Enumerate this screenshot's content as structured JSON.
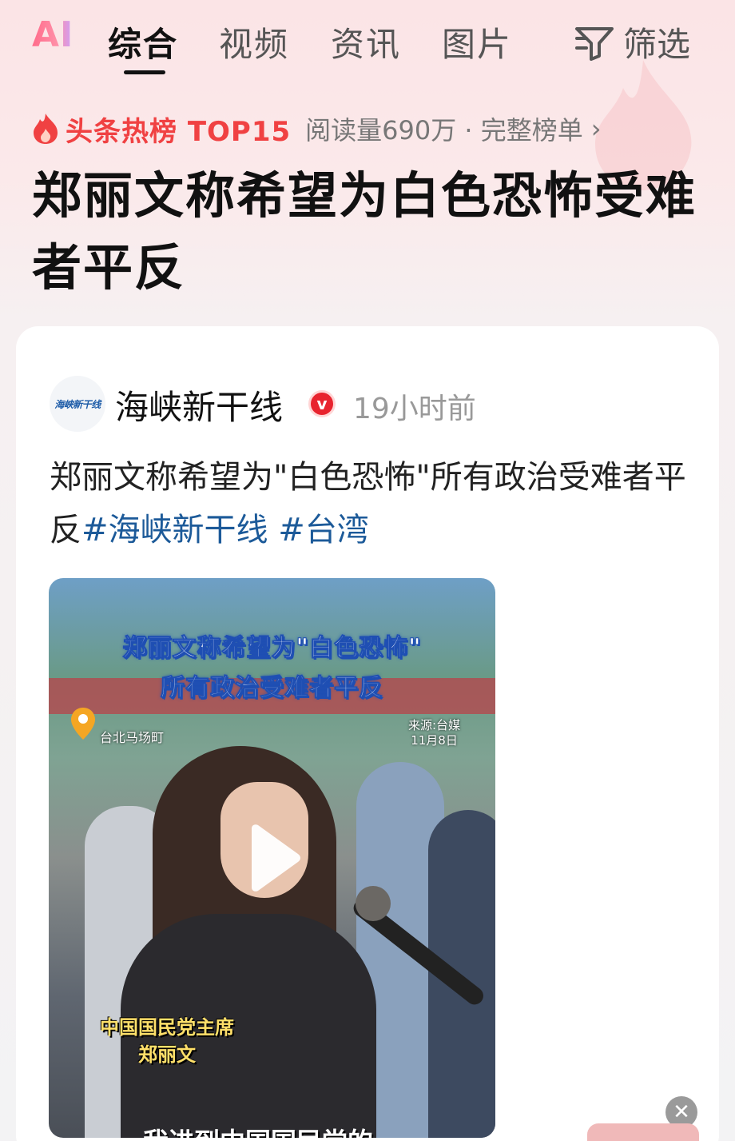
{
  "top_nav": {
    "ai_label": "AI",
    "tabs": [
      {
        "label": "综合",
        "active": true
      },
      {
        "label": "视频",
        "active": false
      },
      {
        "label": "资讯",
        "active": false
      },
      {
        "label": "图片",
        "active": false
      }
    ],
    "filter_label": "筛选",
    "filter_icon": "filter-icon"
  },
  "hot_rank": {
    "label": "头条热榜 TOP15",
    "meta": "阅读量690万 · 完整榜单",
    "chevron": "›",
    "icon": "flame-icon"
  },
  "headline": "郑丽文称希望为白色恐怖受难者平反",
  "post": {
    "source_name": "海峡新干线",
    "avatar_text": "海峡新干线",
    "verified_badge": "v",
    "time": "19小时前",
    "text": "郑丽文称希望为\"白色恐怖\"所有政治受难者平反",
    "hashtags": [
      "#海峡新干线",
      "#台湾"
    ]
  },
  "video": {
    "title_line1": "郑丽文称希望为\"白色恐怖\"",
    "title_line2": "所有政治受难者平反",
    "location": "台北马场町",
    "source_line1": "来源:台媒",
    "source_line2": "11月8日",
    "caption_line1": "中国国民党主席",
    "caption_line2": "郑丽文",
    "subtitle": "我进到中国国民党的",
    "play_icon": "play-icon"
  },
  "close_icon": "close-icon",
  "colors": {
    "accent_red": "#f04142",
    "hashtag_blue": "#1c5a99",
    "badge_red": "#e8232e"
  }
}
